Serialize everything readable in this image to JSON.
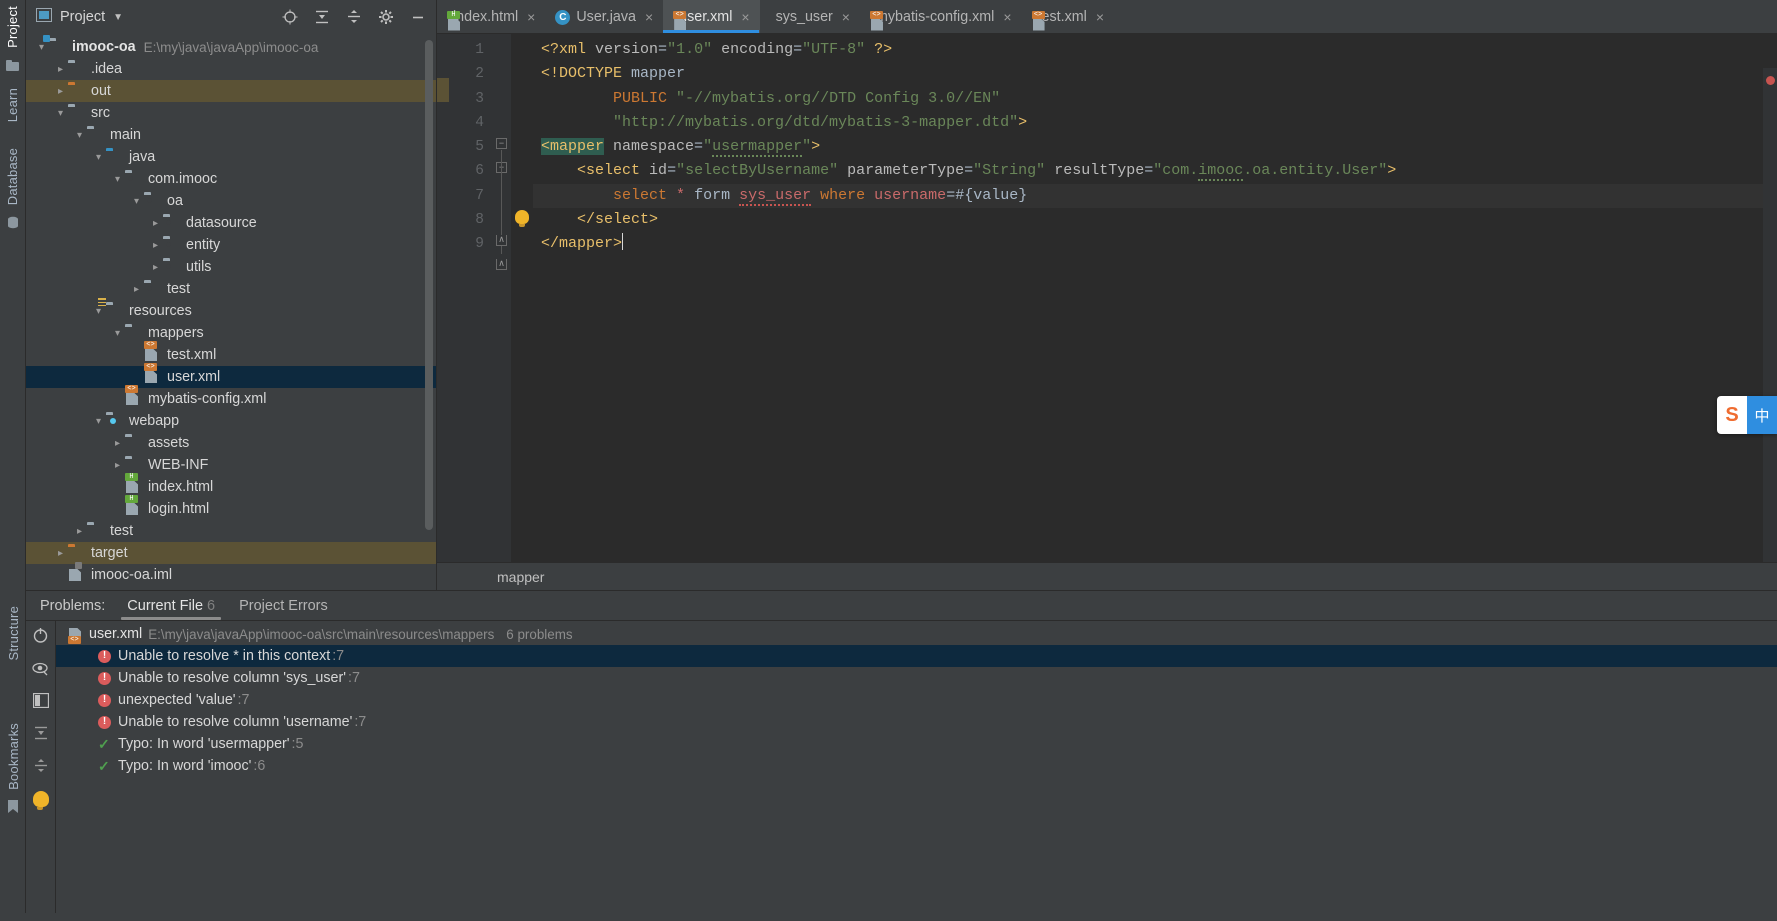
{
  "left_strip": {
    "items": [
      {
        "label": "Project",
        "active": true,
        "icon": "project-icon"
      },
      {
        "label": "Learn",
        "active": false,
        "icon": "learn-icon"
      },
      {
        "label": "Database",
        "active": false,
        "icon": "database-icon"
      }
    ],
    "bottom_items": [
      {
        "label": "Structure",
        "icon": "structure-icon"
      },
      {
        "label": "Bookmarks",
        "icon": "bookmark-icon"
      }
    ]
  },
  "project_panel": {
    "title": "Project",
    "dropdown_icon": "chevron-down-icon",
    "toolbar": [
      {
        "name": "locate-icon",
        "glyph": "⊕"
      },
      {
        "name": "expand-all-icon",
        "glyph": "⤓"
      },
      {
        "name": "collapse-all-icon",
        "glyph": "⤒"
      },
      {
        "name": "gear-icon",
        "glyph": "⚙"
      },
      {
        "name": "minimize-icon",
        "glyph": "—"
      }
    ],
    "tree": [
      {
        "label": "imooc-oa",
        "path": "E:\\my\\java\\javaApp\\imooc-oa",
        "indent": 0,
        "arrow": "down",
        "icon": "module-folder",
        "bold": true,
        "state": "normal"
      },
      {
        "label": ".idea",
        "indent": 1,
        "arrow": "right",
        "icon": "folder-gray",
        "state": "normal"
      },
      {
        "label": "out",
        "indent": 1,
        "arrow": "right",
        "icon": "folder-orange",
        "state": "highlight"
      },
      {
        "label": "src",
        "indent": 1,
        "arrow": "down",
        "icon": "folder-gray",
        "state": "normal"
      },
      {
        "label": "main",
        "indent": 2,
        "arrow": "down",
        "icon": "folder-gray",
        "state": "normal"
      },
      {
        "label": "java",
        "indent": 3,
        "arrow": "down",
        "icon": "folder-blue",
        "state": "normal"
      },
      {
        "label": "com.imooc",
        "indent": 4,
        "arrow": "down",
        "icon": "folder-pkg",
        "state": "normal"
      },
      {
        "label": "oa",
        "indent": 5,
        "arrow": "down",
        "icon": "folder-pkg",
        "state": "normal"
      },
      {
        "label": "datasource",
        "indent": 6,
        "arrow": "right",
        "icon": "folder-pkg",
        "state": "normal"
      },
      {
        "label": "entity",
        "indent": 6,
        "arrow": "right",
        "icon": "folder-pkg",
        "state": "normal"
      },
      {
        "label": "utils",
        "indent": 6,
        "arrow": "right",
        "icon": "folder-pkg",
        "state": "normal"
      },
      {
        "label": "test",
        "indent": 5,
        "arrow": "right",
        "icon": "folder-pkg",
        "state": "normal"
      },
      {
        "label": "resources",
        "indent": 3,
        "arrow": "down",
        "icon": "folder-resources",
        "state": "normal"
      },
      {
        "label": "mappers",
        "indent": 4,
        "arrow": "down",
        "icon": "folder-gray",
        "state": "normal"
      },
      {
        "label": "test.xml",
        "indent": 5,
        "arrow": "none",
        "icon": "xml-file",
        "state": "normal"
      },
      {
        "label": "user.xml",
        "indent": 5,
        "arrow": "none",
        "icon": "xml-file",
        "state": "selected"
      },
      {
        "label": "mybatis-config.xml",
        "indent": 4,
        "arrow": "none",
        "icon": "xml-file",
        "state": "normal"
      },
      {
        "label": "webapp",
        "indent": 3,
        "arrow": "down",
        "icon": "folder-web",
        "state": "normal"
      },
      {
        "label": "assets",
        "indent": 4,
        "arrow": "right",
        "icon": "folder-gray",
        "state": "normal"
      },
      {
        "label": "WEB-INF",
        "indent": 4,
        "arrow": "right",
        "icon": "folder-gray",
        "state": "normal"
      },
      {
        "label": "index.html",
        "indent": 4,
        "arrow": "none",
        "icon": "html-file",
        "state": "normal"
      },
      {
        "label": "login.html",
        "indent": 4,
        "arrow": "none",
        "icon": "html-file",
        "state": "normal"
      },
      {
        "label": "test",
        "indent": 2,
        "arrow": "right",
        "icon": "folder-gray",
        "state": "normal"
      },
      {
        "label": "target",
        "indent": 1,
        "arrow": "right",
        "icon": "folder-orange",
        "state": "highlight"
      },
      {
        "label": "imooc-oa.iml",
        "indent": 1,
        "arrow": "none",
        "icon": "iml-file",
        "state": "normal"
      }
    ]
  },
  "editor": {
    "tabs": [
      {
        "label": "index.html",
        "icon": "html-file-icon",
        "active": false
      },
      {
        "label": "User.java",
        "icon": "java-class-icon",
        "active": false
      },
      {
        "label": "user.xml",
        "icon": "xml-file-icon",
        "active": true
      },
      {
        "label": "sys_user",
        "icon": "database-table-icon",
        "active": false
      },
      {
        "label": "mybatis-config.xml",
        "icon": "xml-file-icon",
        "active": false
      },
      {
        "label": "test.xml",
        "icon": "xml-file-icon",
        "active": false
      }
    ],
    "close_glyph": "×",
    "line_numbers": [
      "1",
      "2",
      "3",
      "4",
      "5",
      "6",
      "7",
      "8",
      "9"
    ],
    "code_lines": [
      "<?xml version=\"1.0\" encoding=\"UTF-8\" ?>",
      "<!DOCTYPE mapper",
      "        PUBLIC \"-//mybatis.org//DTD Config 3.0//EN\"",
      "        \"http://mybatis.org/dtd/mybatis-3-mapper.dtd\">",
      "<mapper namespace=\"usermapper\">",
      "    <select id=\"selectByUsername\" parameterType=\"String\" resultType=\"com.imooc.oa.entity.User\">",
      "        select * form sys_user where username=#{value}",
      "    </select>",
      "</mapper>"
    ],
    "breadcrumb": "mapper",
    "error_marker": "error-stripe"
  },
  "problems": {
    "label": "Problems:",
    "tabs": [
      {
        "label": "Current File",
        "count": "6",
        "active": true
      },
      {
        "label": "Project Errors",
        "count": "",
        "active": false
      }
    ],
    "file": {
      "name": "user.xml",
      "path": "E:\\my\\java\\javaApp\\imooc-oa\\src\\main\\resources\\mappers",
      "count": "6 problems"
    },
    "items": [
      {
        "text": "Unable to resolve * in this context",
        "line": ":7",
        "severity": "error",
        "selected": true
      },
      {
        "text": "Unable to resolve column 'sys_user'",
        "line": ":7",
        "severity": "error",
        "selected": false
      },
      {
        "text": "unexpected 'value'",
        "line": ":7",
        "severity": "error",
        "selected": false
      },
      {
        "text": "Unable to resolve column 'username'",
        "line": ":7",
        "severity": "error",
        "selected": false
      },
      {
        "text": "Typo: In word 'usermapper'",
        "line": ":5",
        "severity": "typo",
        "selected": false
      },
      {
        "text": "Typo: In word 'imooc'",
        "line": ":6",
        "severity": "typo",
        "selected": false
      }
    ],
    "side_icons": [
      {
        "name": "rerun-icon",
        "glyph": "↻"
      },
      {
        "name": "eye-icon",
        "glyph": "◉"
      },
      {
        "name": "preview-icon",
        "glyph": "▣"
      },
      {
        "name": "expand-all-icon",
        "glyph": "⤓"
      },
      {
        "name": "collapse-all-icon",
        "glyph": "⤒"
      },
      {
        "name": "lightbulb-icon",
        "glyph": "●"
      }
    ]
  },
  "floating_widget": {
    "logo": "S",
    "mode": "中",
    "name": "sogou-ime-indicator"
  },
  "colors": {
    "accent": "#2f8ee0",
    "selection": "#0d293e",
    "error": "#c75450",
    "tag": "#e8bf6a",
    "string": "#6a8759",
    "keyword": "#cc7832",
    "highlight_row": "#5b5235"
  }
}
